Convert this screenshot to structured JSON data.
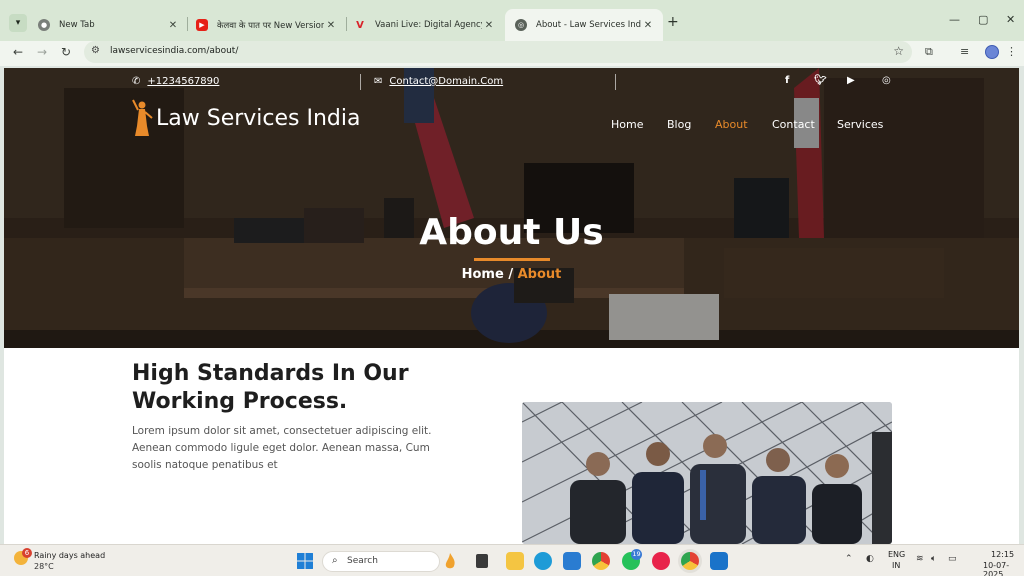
{
  "browser": {
    "tabs": [
      {
        "label": "New Tab",
        "icon": "chrome-icon",
        "color": "#7a7f7a"
      },
      {
        "label": "केलवा के पात पर New Version, Ke",
        "icon": "youtube-icon",
        "color": "#e62117"
      },
      {
        "label": "Vaani Live: Digital Agency, Web",
        "icon": "vaani-icon",
        "color": "#d8232a"
      },
      {
        "label": "About - Law Services India",
        "icon": "globe-icon",
        "color": "#5a625a"
      }
    ],
    "url": "lawservicesindia.com/about/"
  },
  "site": {
    "phone": "+1234567890",
    "email": "Contact@Domain.Com",
    "brand": "Law Services India",
    "accent": "#e88a2a",
    "menu": [
      "Home",
      "Blog",
      "About",
      "Contact",
      "Services"
    ],
    "active_menu": "About",
    "hero_title": "About Us",
    "breadcrumb_home": "Home",
    "breadcrumb_sep": "/",
    "breadcrumb_current": "About",
    "about_title": "High Standards In Our Working Process.",
    "about_text": "Lorem ipsum dolor sit amet, consectetuer adipiscing elit. Aenean commodo ligule eget dolor. Aenean massa, Cum soolis natoque penatibus et"
  },
  "taskbar": {
    "weather_line1": "Rainy days ahead",
    "weather_line2": "28°C",
    "weather_badge": "6",
    "search_placeholder": "Search",
    "whatsapp_badge": "19",
    "lang_line1": "ENG",
    "lang_line2": "IN",
    "time": "12:15",
    "date": "10-07-2025"
  }
}
